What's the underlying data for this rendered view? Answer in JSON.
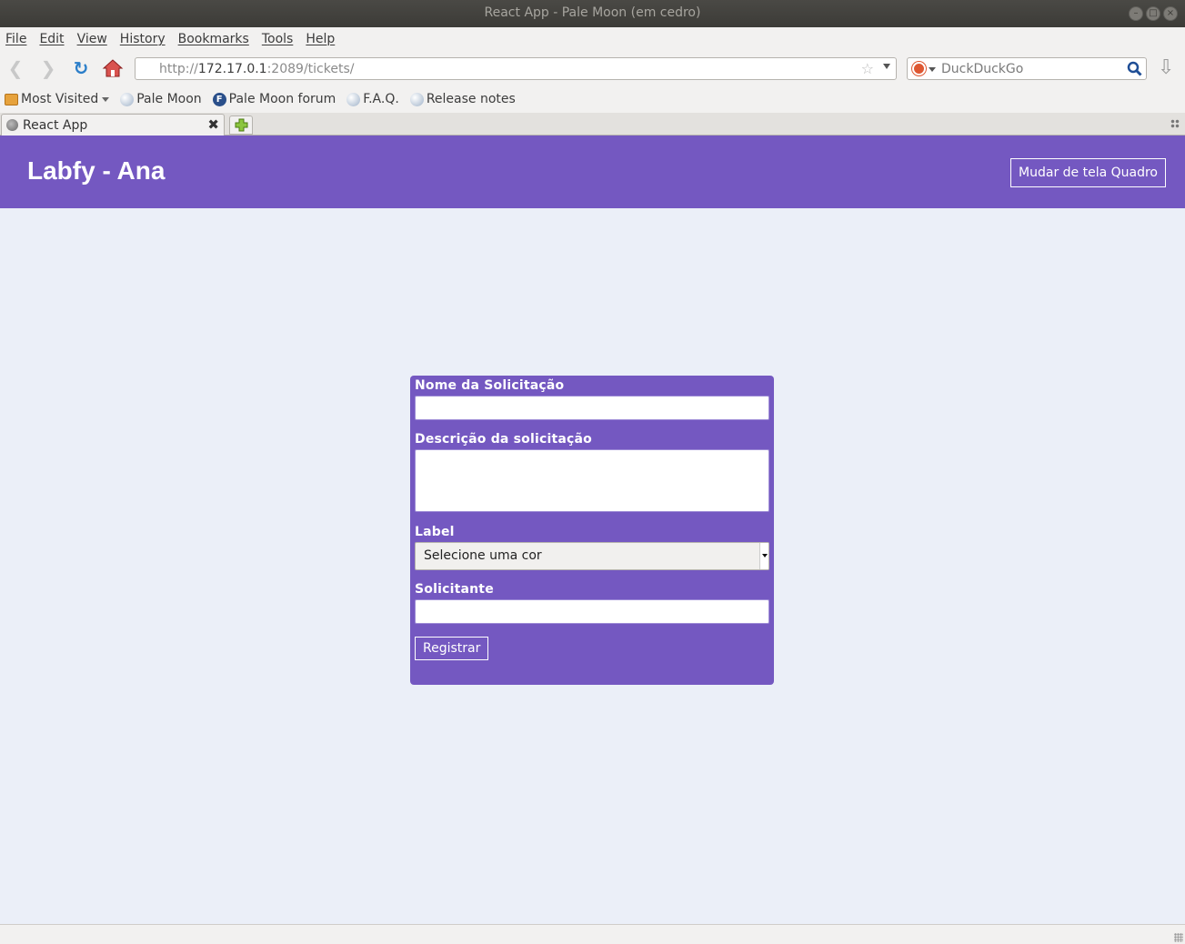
{
  "window": {
    "title": "React App - Pale Moon (em cedro)"
  },
  "menubar": {
    "items": [
      "File",
      "Edit",
      "View",
      "History",
      "Bookmarks",
      "Tools",
      "Help"
    ]
  },
  "navbar": {
    "url_scheme": "http://",
    "url_host": "172.17.0.1",
    "url_rest": ":2089/tickets/",
    "search_placeholder": "DuckDuckGo"
  },
  "bookmarks": {
    "items": [
      "Most Visited",
      "Pale Moon",
      "Pale Moon forum",
      "F.A.Q.",
      "Release notes"
    ]
  },
  "tabs": [
    {
      "label": "React App"
    }
  ],
  "app": {
    "title": "Labfy - Ana",
    "switch_button": "Mudar de tela Quadro",
    "accent": "#7458c1",
    "background": "#ebeff8"
  },
  "form": {
    "name_label": "Nome da Solicitação",
    "name_value": "",
    "description_label": "Descrição da solicitação",
    "description_value": "",
    "label_label": "Label",
    "label_selected": "Selecione uma cor",
    "requester_label": "Solicitante",
    "requester_value": "",
    "submit_label": "Registrar"
  }
}
